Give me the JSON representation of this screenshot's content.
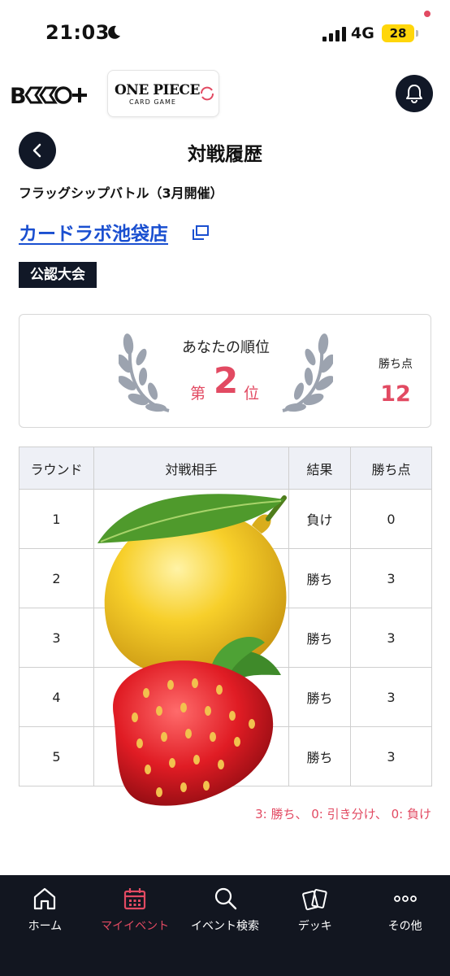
{
  "status_bar": {
    "time": "21:03",
    "network": "4G",
    "battery": "28"
  },
  "header": {
    "brand_logo": "B",
    "game_logo_title": "ONE PIECE",
    "game_logo_subtitle": "CARD GAME"
  },
  "page": {
    "title": "対戦履歴",
    "event_name": "フラッグシップバトル（3月開催）",
    "store_name": "カードラボ池袋店",
    "category_badge": "公認大会"
  },
  "rank_card": {
    "label": "あなたの順位",
    "rank_prefix": "第",
    "rank_value": "2",
    "rank_suffix": "位",
    "points_label": "勝ち点",
    "points_value": "12"
  },
  "results_table": {
    "headers": [
      "ラウンド",
      "対戦相手",
      "結果",
      "勝ち点"
    ],
    "rows": [
      {
        "round": "1",
        "opponent": "",
        "result": "負け",
        "points": "0"
      },
      {
        "round": "2",
        "opponent": "",
        "result": "勝ち",
        "points": "3"
      },
      {
        "round": "3",
        "opponent": "",
        "result": "勝ち",
        "points": "3"
      },
      {
        "round": "4",
        "opponent": "",
        "result": "勝ち",
        "points": "3"
      },
      {
        "round": "5",
        "opponent": "",
        "result": "勝ち",
        "points": "3"
      }
    ]
  },
  "summary": "3: 勝ち、 0: 引き分け、 0: 負け",
  "bottom_nav": {
    "items": [
      {
        "label": "ホーム",
        "icon": "home-icon",
        "active": false
      },
      {
        "label": "マイイベント",
        "icon": "calendar-icon",
        "active": true
      },
      {
        "label": "イベント検索",
        "icon": "search-icon",
        "active": false
      },
      {
        "label": "デッキ",
        "icon": "cards-icon",
        "active": false
      },
      {
        "label": "その他",
        "icon": "more-icon",
        "active": false
      }
    ]
  },
  "colors": {
    "accent": "#e24a62",
    "dark": "#111827",
    "link": "#1a4fd0",
    "table_header_bg": "#eef0f6"
  }
}
